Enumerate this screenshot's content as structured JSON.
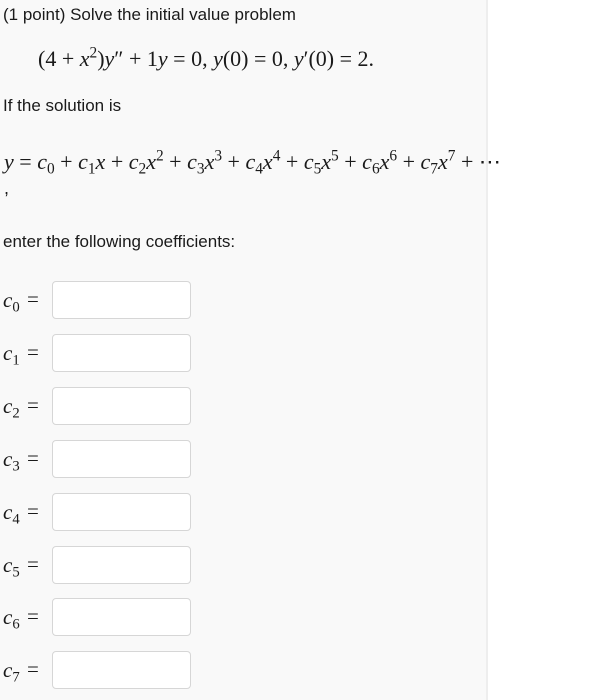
{
  "problem": {
    "header": "(1 point) Solve the initial value problem",
    "ode_parts": {
      "lhs_a": "(4 + ",
      "x": "x",
      "exp2": "2",
      "lhs_b": ")",
      "y": "y",
      "primes": "″",
      "rest": " + 1",
      "y2": "y",
      "eq0": " = 0, ",
      "y3": "y",
      "ic1": "(0) = 0, ",
      "y4": "y",
      "prime1": "′",
      "ic2": "(0) = 2."
    },
    "intro": "If the solution is",
    "series_prefix": "y",
    "series_equals": " = ",
    "series_terms": [
      {
        "coef": "c",
        "sub": "0",
        "var": "",
        "exp": ""
      },
      {
        "coef": "c",
        "sub": "1",
        "var": "x",
        "exp": ""
      },
      {
        "coef": "c",
        "sub": "2",
        "var": "x",
        "exp": "2"
      },
      {
        "coef": "c",
        "sub": "3",
        "var": "x",
        "exp": "3"
      },
      {
        "coef": "c",
        "sub": "4",
        "var": "x",
        "exp": "4"
      },
      {
        "coef": "c",
        "sub": "5",
        "var": "x",
        "exp": "5"
      },
      {
        "coef": "c",
        "sub": "6",
        "var": "x",
        "exp": "6"
      },
      {
        "coef": "c",
        "sub": "7",
        "var": "x",
        "exp": "7"
      }
    ],
    "series_tail": " + ⋯",
    "comma": ",",
    "instruction": "enter the following coefficients:"
  },
  "answers": [
    {
      "label": "c",
      "sub": "0",
      "equals": "=",
      "value": ""
    },
    {
      "label": "c",
      "sub": "1",
      "equals": "=",
      "value": ""
    },
    {
      "label": "c",
      "sub": "2",
      "equals": "=",
      "value": ""
    },
    {
      "label": "c",
      "sub": "3",
      "equals": "=",
      "value": ""
    },
    {
      "label": "c",
      "sub": "4",
      "equals": "=",
      "value": ""
    },
    {
      "label": "c",
      "sub": "5",
      "equals": "=",
      "value": ""
    },
    {
      "label": "c",
      "sub": "6",
      "equals": "=",
      "value": ""
    },
    {
      "label": "c",
      "sub": "7",
      "equals": "=",
      "value": ""
    }
  ]
}
